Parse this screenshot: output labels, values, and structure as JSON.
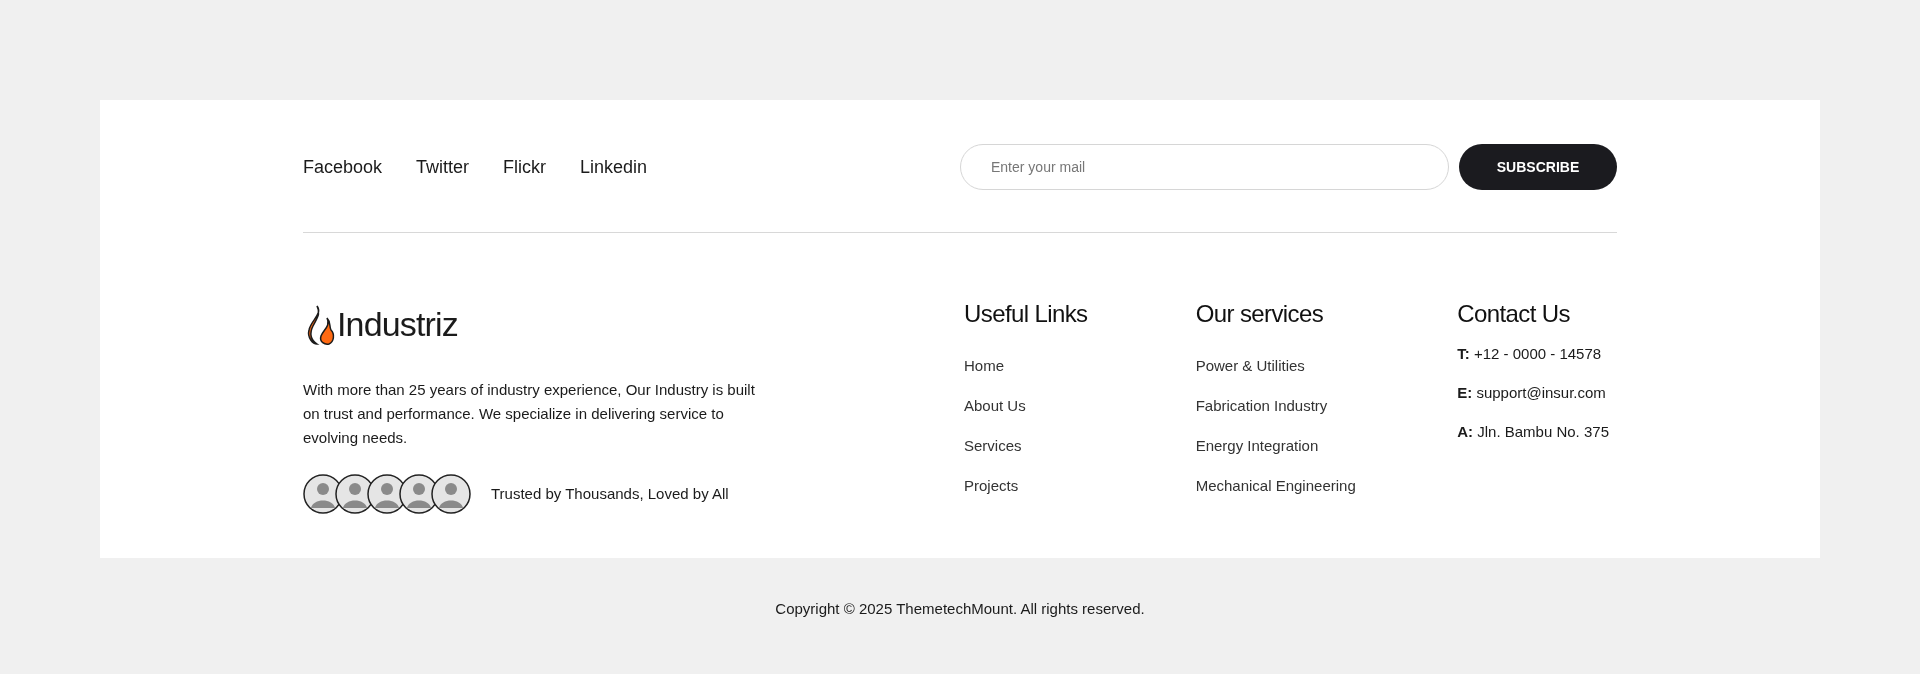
{
  "social_links": [
    "Facebook",
    "Twitter",
    "Flickr",
    "Linkedin"
  ],
  "subscribe": {
    "placeholder": "Enter your mail",
    "button": "SUBSCRIBE"
  },
  "brand": {
    "name": "Industriz",
    "description": "With more than 25 years of industry experience, Our Industry is built on trust and performance. We specialize in delivering service to evolving needs.",
    "avatar_count_label": "Trusted by Thousands, Loved by All",
    "avatars": [
      {
        "kind": "person"
      },
      {
        "kind": "person"
      },
      {
        "kind": "person"
      },
      {
        "kind": "person"
      },
      {
        "kind": "person"
      }
    ]
  },
  "columns": [
    {
      "title": "Useful Links",
      "kind": "links",
      "items": [
        "Home",
        "About Us",
        "Services",
        "Projects"
      ]
    },
    {
      "title": "Our services",
      "kind": "links",
      "items": [
        "Power & Utilities",
        "Fabrication Industry",
        "Energy Integration",
        "Mechanical Engineering"
      ]
    },
    {
      "title": "Contact Us",
      "kind": "contact",
      "items": [
        "**T:** +12 - 0000 - 14578",
        "**E:** support@insur.com",
        "**A:** Jln. Bambu No. 375"
      ]
    }
  ],
  "copyright": "Copyright © 2025 ThemetechMount. All rights reserved."
}
